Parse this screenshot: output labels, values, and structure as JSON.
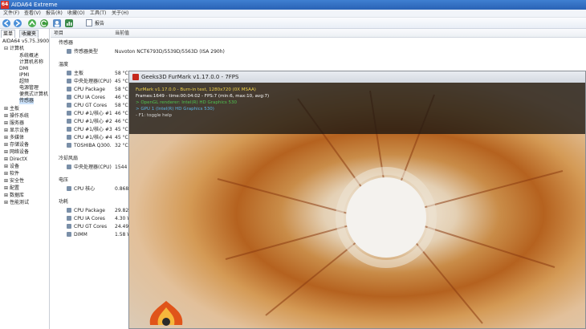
{
  "window": {
    "icon_text": "64",
    "title": "AIDA64 Extreme"
  },
  "menu": [
    "文件(F)",
    "查看(V)",
    "报告(R)",
    "收藏(O)",
    "工具(T)",
    "关于(H)"
  ],
  "toolbar": {
    "report_label": "报告"
  },
  "left_tabs": [
    "菜单",
    "收藏夹"
  ],
  "tree": {
    "root": "AIDA64 v5.75.3900",
    "computer": "计算机",
    "computer_children": [
      "系统概述",
      "计算机名称",
      "DMI",
      "IPMI",
      "超频",
      "电源管理",
      "便携式计算机",
      "传感器"
    ],
    "categories": [
      "主板",
      "操作系统",
      "服务器",
      "显示设备",
      "多媒体",
      "存储设备",
      "网络设备",
      "DirectX",
      "设备",
      "软件",
      "安全性",
      "配置",
      "数据库",
      "性能测试"
    ]
  },
  "columns": {
    "item": "项目",
    "value": "当前值"
  },
  "sensor_rows": [
    {
      "type": "group",
      "label": "传感器"
    },
    {
      "type": "row",
      "label": "传感器类型",
      "value": "Nuvoton NCT6793D/5539D/5563D  (ISA 290h)"
    },
    {
      "type": "group",
      "label": "温度"
    },
    {
      "type": "row",
      "label": "主板",
      "value": "58 °C"
    },
    {
      "type": "row",
      "label": "中央处理器(CPU)",
      "value": "45 °C"
    },
    {
      "type": "row",
      "label": "CPU Package",
      "value": "58 °C"
    },
    {
      "type": "row",
      "label": "CPU IA Cores",
      "value": "46 °C"
    },
    {
      "type": "row",
      "label": "CPU GT Cores",
      "value": "58 °C"
    },
    {
      "type": "row",
      "label": "CPU #1/核心 #1",
      "value": "46 °C"
    },
    {
      "type": "row",
      "label": "CPU #1/核心 #2",
      "value": "46 °C"
    },
    {
      "type": "row",
      "label": "CPU #1/核心 #3",
      "value": "45 °C"
    },
    {
      "type": "row",
      "label": "CPU #1/核心 #4",
      "value": "45 °C"
    },
    {
      "type": "row",
      "label": "TOSHIBA Q300.",
      "value": "32 °C"
    },
    {
      "type": "group",
      "label": "冷却风扇"
    },
    {
      "type": "row",
      "label": "中央处理器(CPU)",
      "value": "1544 RPM"
    },
    {
      "type": "group",
      "label": "电压"
    },
    {
      "type": "row",
      "label": "CPU 核心",
      "value": "0.868 V"
    },
    {
      "type": "group",
      "label": "功耗"
    },
    {
      "type": "row",
      "label": "CPU Package",
      "value": "29.82 W"
    },
    {
      "type": "row",
      "label": "CPU IA Cores",
      "value": "4.30 W"
    },
    {
      "type": "row",
      "label": "CPU GT Cores",
      "value": "24.49 W"
    },
    {
      "type": "row",
      "label": "DIMM",
      "value": "1.58 W"
    }
  ],
  "furmark": {
    "title": "Geeks3D FurMark v1.17.0.0 - 7FPS",
    "hud": [
      {
        "text": "FurMark v1.17.0.0 - Burn-in test, 1280x720 (0X MSAA)",
        "color": "#f2d44a"
      },
      {
        "text": "Frames:1649 - time:00:04:02 - FPS:7 (min:6, max:10, avg:7)",
        "color": "#ffffff"
      },
      {
        "text": "> OpenGL renderer: Intel(R) HD Graphics 530",
        "color": "#4fc24f"
      },
      {
        "text": "> GPU 1 (Intel(R) HD Graphics 530)",
        "color": "#5ab4e6"
      },
      {
        "text": "- F1: toggle help",
        "color": "#d8d8d8"
      }
    ]
  }
}
